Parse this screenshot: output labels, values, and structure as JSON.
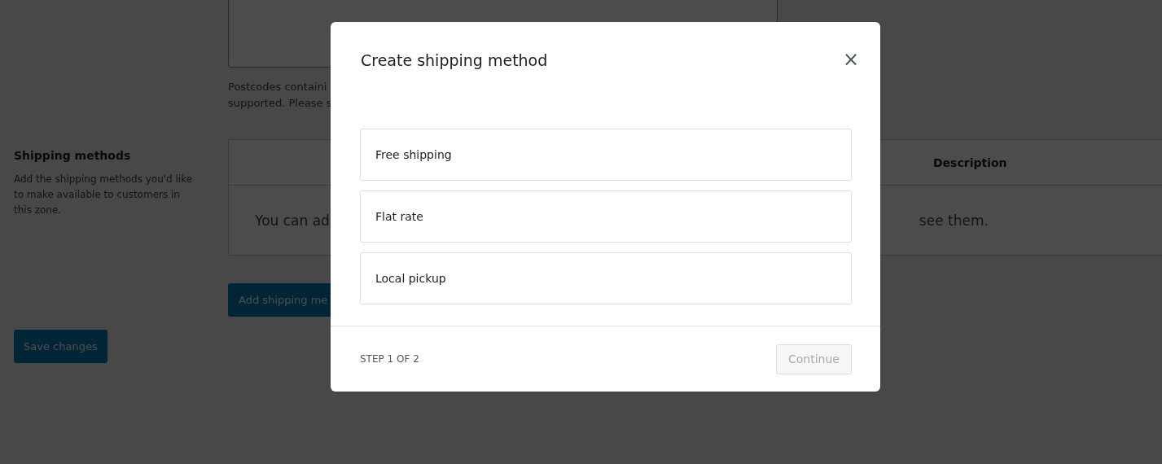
{
  "page": {
    "help_text": [
      "Postcodes containi",
      "supported. Please s"
    ],
    "section": {
      "title": "Shipping methods",
      "description": "Add the shipping methods you'd like to make available to customers in this zone."
    },
    "table": {
      "columns": [
        "Description"
      ],
      "empty_text_left": "You can ad",
      "empty_text_right": "see them."
    },
    "add_button": "Add shipping me",
    "save_button": "Save changes"
  },
  "modal": {
    "title": "Create shipping method",
    "close": "×",
    "options": [
      {
        "label": "Free shipping",
        "selected": false
      },
      {
        "label": "Flat rate",
        "selected": false
      },
      {
        "label": "Local pickup",
        "selected": false
      }
    ],
    "step": "STEP 1 OF 2",
    "continue": {
      "label": "Continue",
      "disabled": true
    }
  }
}
